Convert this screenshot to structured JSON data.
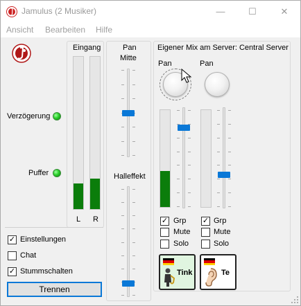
{
  "window": {
    "title": "Jamulus (2 Musiker)",
    "buttons": {
      "minimize": "—",
      "maximize": "☐",
      "close": "✕"
    }
  },
  "menu": {
    "items": [
      "Ansicht",
      "Bearbeiten",
      "Hilfe"
    ]
  },
  "status": {
    "delay_label": "Verzögerung",
    "buffer_label": "Puffer"
  },
  "input": {
    "title": "Eingang",
    "left_label": "L",
    "right_label": "R",
    "left_level": 0.17,
    "right_level": 0.2
  },
  "pan": {
    "title": "Pan",
    "center_label": "Mitte",
    "pan_value": 0.5,
    "reverb_label": "Halleffekt",
    "reverb_value": 0.1
  },
  "options": {
    "settings_label": "Einstellungen",
    "chat_label": "Chat",
    "mute_label": "Stummschalten",
    "settings_checked": true,
    "chat_checked": false,
    "mute_checked": true,
    "disconnect_label": "Trennen"
  },
  "mixer": {
    "title": "Eigener Mix am Server: Central Server",
    "channels": [
      {
        "pan_label": "Pan",
        "level": 0.37,
        "fader": 0.82,
        "grp_label": "Grp",
        "grp_checked": true,
        "mute_label": "Mute",
        "mute_checked": false,
        "solo_label": "Solo",
        "solo_checked": false,
        "name": "Tink",
        "instrument_icon": "saxophone-player-icon",
        "flag": "germany-flag-icon"
      },
      {
        "pan_label": "Pan",
        "level": 0.0,
        "fader": 0.32,
        "grp_label": "Grp",
        "grp_checked": true,
        "mute_label": "Mute",
        "mute_checked": false,
        "solo_label": "Solo",
        "solo_checked": false,
        "name": "Te",
        "instrument_icon": "ear-icon",
        "flag": "germany-flag-icon"
      }
    ]
  },
  "colors": {
    "meter_green": "#0b7d0b",
    "accent_blue": "#0a78d7",
    "channel_bg": "#e0f5e0",
    "channel_bg_2": "#ffffff"
  }
}
